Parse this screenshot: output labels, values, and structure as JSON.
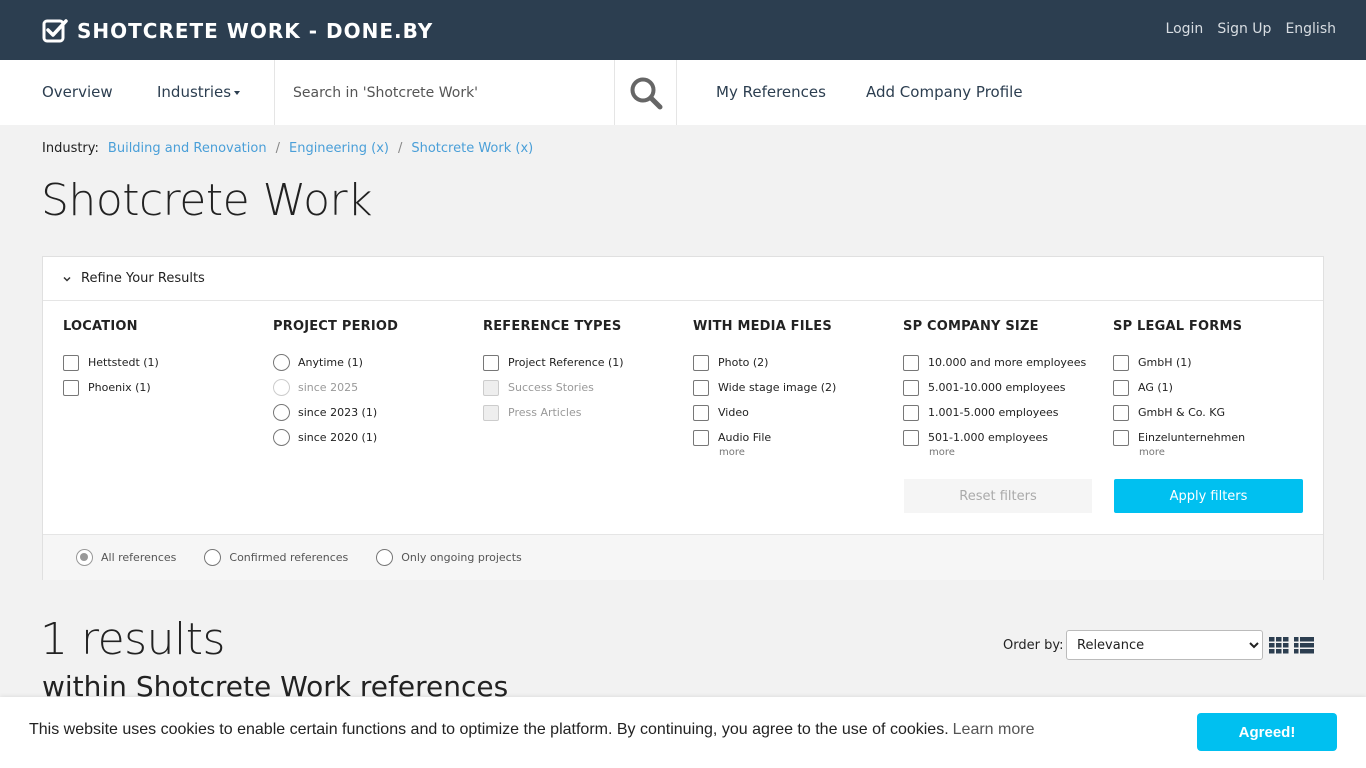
{
  "header": {
    "logo_text": "SHOTCRETE WORK - DONE.BY",
    "links": [
      "Login",
      "Sign Up",
      "English"
    ]
  },
  "nav": {
    "overview": "Overview",
    "industries": "Industries",
    "search_placeholder": "Search in 'Shotcrete Work'",
    "my_references": "My References",
    "add_company_profile": "Add Company Profile"
  },
  "breadcrumb": {
    "label": "Industry:",
    "items": [
      "Building and Renovation",
      "Engineering (x)",
      "Shotcrete Work (x)"
    ],
    "separator": "/"
  },
  "page_title": "Shotcrete Work",
  "filters": {
    "header": "Refine Your Results",
    "columns": [
      {
        "title": "LOCATION",
        "type": "checkbox",
        "options": [
          {
            "label": "Hettstedt (1)",
            "disabled": false
          },
          {
            "label": "Phoenix (1)",
            "disabled": false
          }
        ],
        "more": ""
      },
      {
        "title": "PROJECT PERIOD",
        "type": "radio",
        "options": [
          {
            "label": "Anytime (1)",
            "disabled": false
          },
          {
            "label": "since 2025",
            "disabled": true
          },
          {
            "label": "since 2023 (1)",
            "disabled": false
          },
          {
            "label": "since 2020 (1)",
            "disabled": false
          }
        ],
        "more": ""
      },
      {
        "title": "REFERENCE TYPES",
        "type": "checkbox",
        "options": [
          {
            "label": "Project Reference (1)",
            "disabled": false
          },
          {
            "label": "Success Stories",
            "disabled": true
          },
          {
            "label": "Press Articles",
            "disabled": true
          }
        ],
        "more": ""
      },
      {
        "title": "WITH MEDIA FILES",
        "type": "checkbox",
        "options": [
          {
            "label": "Photo (2)",
            "disabled": false
          },
          {
            "label": "Wide stage image (2)",
            "disabled": false
          },
          {
            "label": "Video",
            "disabled": false
          },
          {
            "label": "Audio File",
            "disabled": false
          }
        ],
        "more": "more"
      },
      {
        "title": "SP COMPANY SIZE",
        "type": "checkbox",
        "options": [
          {
            "label": "10.000 and more employees",
            "disabled": false
          },
          {
            "label": "5.001-10.000 employees",
            "disabled": false
          },
          {
            "label": "1.001-5.000 employees",
            "disabled": false
          },
          {
            "label": "501-1.000 employees",
            "disabled": false
          }
        ],
        "more": "more"
      },
      {
        "title": "SP LEGAL FORMS",
        "type": "checkbox",
        "options": [
          {
            "label": "GmbH (1)",
            "disabled": false
          },
          {
            "label": "AG (1)",
            "disabled": false
          },
          {
            "label": "GmbH & Co. KG",
            "disabled": false
          },
          {
            "label": "Einzelunternehmen",
            "disabled": false
          }
        ],
        "more": "more"
      }
    ],
    "reset_label": "Reset filters",
    "apply_label": "Apply filters",
    "scope_options": [
      {
        "label": "All references",
        "checked": true
      },
      {
        "label": "Confirmed references",
        "checked": false
      },
      {
        "label": "Only ongoing projects",
        "checked": false
      }
    ]
  },
  "results": {
    "count_text": "1 results",
    "subtitle": "within Shotcrete Work references",
    "order_label": "Order by:",
    "order_selected": "Relevance"
  },
  "cookie": {
    "text": "This website uses cookies to enable certain functions and to optimize the platform. By continuing, you agree to the use of cookies.",
    "learn_more": "Learn more",
    "button": "Agreed!"
  },
  "colors": {
    "topbar": "#2c3e50",
    "accent": "#00c0f0",
    "link": "#4a9fd8"
  }
}
